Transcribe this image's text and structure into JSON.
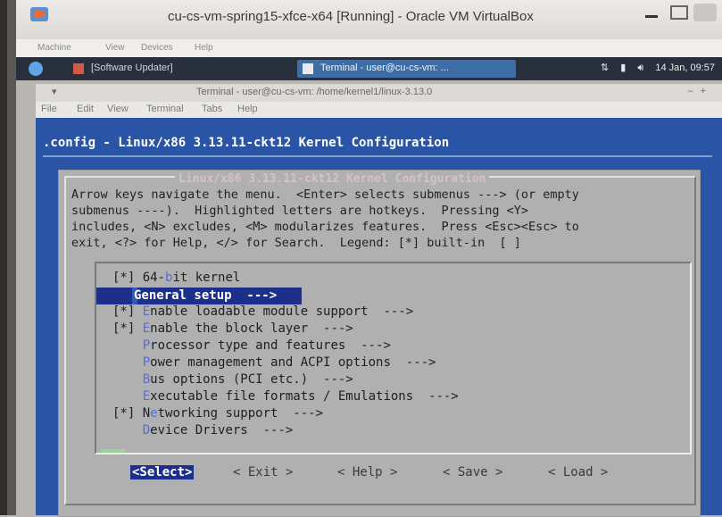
{
  "vbox": {
    "title": "cu-cs-vm-spring15-xfce-x64 [Running] - Oracle VM VirtualBox",
    "menu": [
      "Machine",
      "View",
      "Devices",
      "Help"
    ]
  },
  "panel": {
    "task_updater": "[Software Updater]",
    "task_terminal": "Terminal - user@cu-cs-vm: ...",
    "clock": "14 Jan, 09:57"
  },
  "terminal": {
    "title": "Terminal - user@cu-cs-vm: /home/kernel1/linux-3.13.0",
    "menu": [
      "File",
      "Edit",
      "View",
      "Terminal",
      "Tabs",
      "Help"
    ]
  },
  "config": {
    "header": ".config - Linux/x86 3.13.11-ckt12 Kernel Configuration",
    "dialog_title": "Linux/x86 3.13.11-ckt12 Kernel Configuration",
    "help_line1": "Arrow keys navigate the menu.  <Enter> selects submenus ---> (or empty",
    "help_line2": "submenus ----).  Highlighted letters are hotkeys.  Pressing <Y>",
    "help_line3": "includes, <N> excludes, <M> modularizes features.  Press <Esc><Esc> to",
    "help_line4": "exit, <?> for Help, </> for Search.  Legend: [*] built-in  [ ]",
    "items": [
      {
        "mark": "[*] ",
        "hot": "",
        "text": "64-",
        "hk": "b",
        "rest": "it kernel"
      },
      {
        "mark": "",
        "hot": "",
        "text": "General setup  --->",
        "hk": "",
        "rest": ""
      },
      {
        "mark": "[*] ",
        "hot": "E",
        "text": "",
        "hk": "",
        "rest": "nable loadable module support  --->"
      },
      {
        "mark": "[*] ",
        "hot": "E",
        "text": "",
        "hk": "",
        "rest": "nable the block layer  --->"
      },
      {
        "mark": "    ",
        "hot": "P",
        "text": "",
        "hk": "",
        "rest": "rocessor type and features  --->"
      },
      {
        "mark": "    ",
        "hot": "P",
        "text": "",
        "hk": "",
        "rest": "ower management and ACPI options  --->"
      },
      {
        "mark": "    ",
        "hot": "B",
        "text": "",
        "hk": "",
        "rest": "us options (PCI etc.)  --->"
      },
      {
        "mark": "    ",
        "hot": "E",
        "text": "",
        "hk": "",
        "rest": "xecutable file formats / Emulations  --->"
      },
      {
        "mark": "[*] ",
        "hot": "",
        "text": "N",
        "hk": "e",
        "rest": "tworking support  --->"
      },
      {
        "mark": "    ",
        "hot": "D",
        "text": "",
        "hk": "",
        "rest": "evice Drivers  --->"
      }
    ],
    "buttons": {
      "select": "<Select>",
      "exit": "< Exit >",
      "help": "< Help >",
      "save": "< Save >",
      "load": "< Load >"
    }
  }
}
